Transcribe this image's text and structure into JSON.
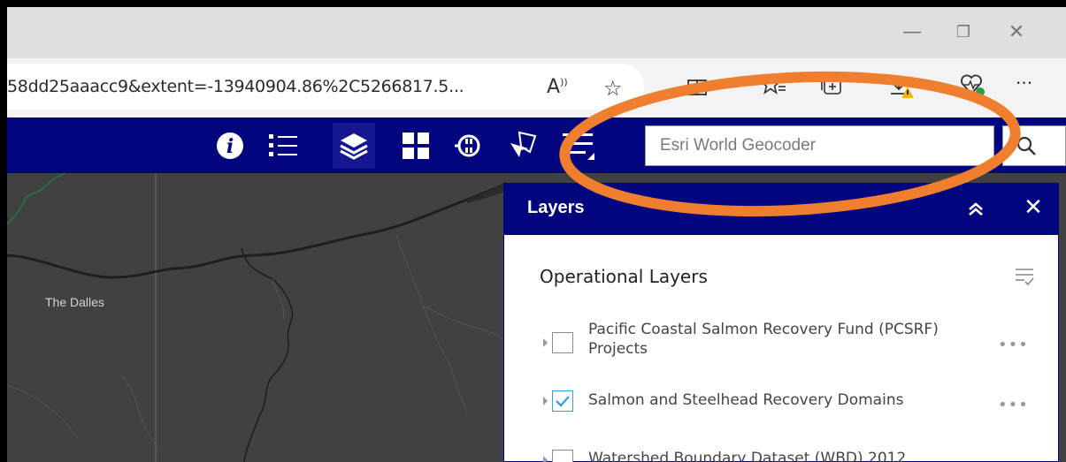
{
  "browser": {
    "url_text": "58dd25aaacc9&extent=-13940904.86%2C5266817.5...",
    "window_controls": {
      "minimize": "—",
      "restore": "❐",
      "close": "✕"
    },
    "toolbar_icons": [
      "read-aloud-icon",
      "favorite-star-icon",
      "split-screen-icon",
      "favorites-list-icon",
      "collections-icon",
      "downloads-icon",
      "browser-essentials-icon",
      "more-menu-icon"
    ],
    "more_label": "···",
    "read_aloud_label": "A",
    "read_aloud_sup": "))"
  },
  "app_header": {
    "tools": [
      "about-icon",
      "legend-icon",
      "layers-icon",
      "basemap-gallery-icon",
      "analysis-icon",
      "select-icon",
      "layer-list-alt-icon"
    ],
    "active_tool": "layers-icon",
    "search": {
      "placeholder": "Esri World Geocoder",
      "value": ""
    }
  },
  "map": {
    "labels": [
      {
        "text": "The Dalles"
      }
    ]
  },
  "layers_panel": {
    "title": "Layers",
    "close_label": "✕",
    "section_title": "Operational Layers",
    "layers": [
      {
        "name": "Pacific Coastal Salmon Recovery Fund (PCSRF) Projects",
        "checked": false
      },
      {
        "name": "Salmon and Steelhead Recovery Domains",
        "checked": true
      },
      {
        "name": "Watershed Boundary Dataset (WBD) 2012",
        "checked": false
      }
    ],
    "more_label": "•••"
  },
  "colors": {
    "header_bg": "#02057e",
    "annotation": "#ef7e2f",
    "checkbox_accent": "#34a5d6"
  }
}
